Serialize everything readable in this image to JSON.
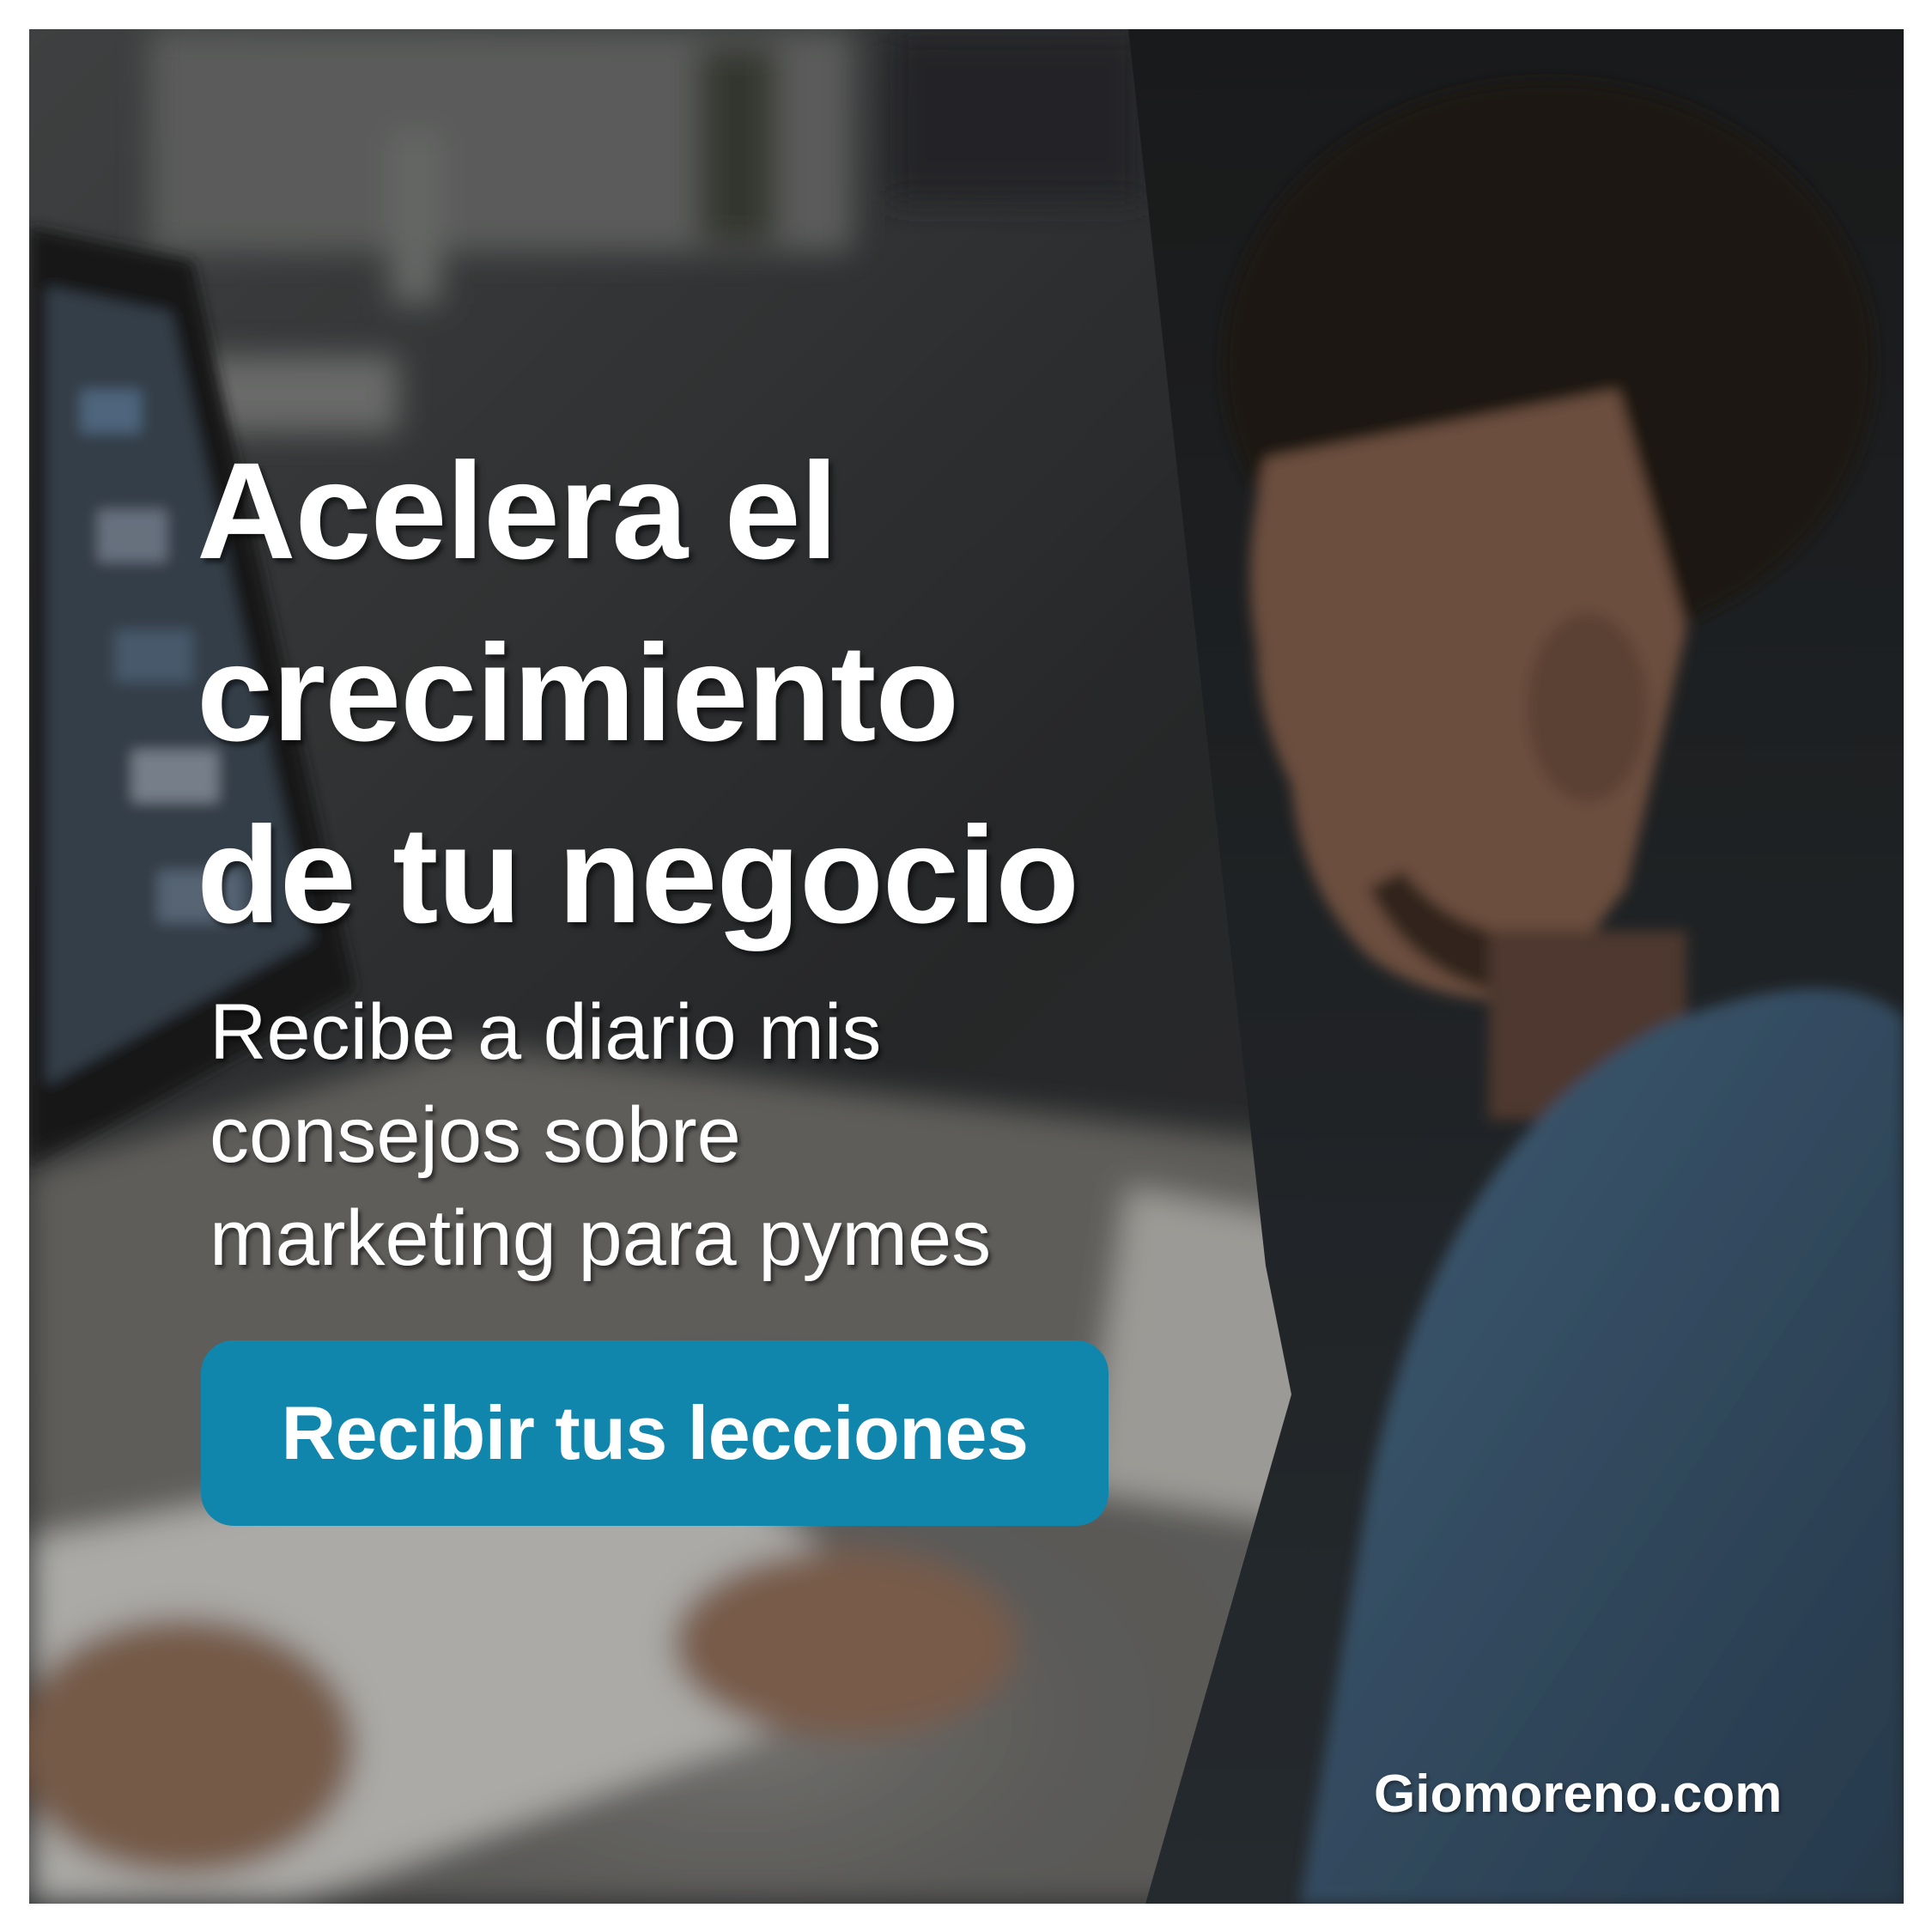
{
  "headline_lines": [
    "Acelera el",
    "crecimiento",
    "de tu negocio"
  ],
  "subheadline_lines": [
    "Recibe a diario mis",
    "consejos sobre",
    "marketing para pymes"
  ],
  "cta_label": "Recibir tus lecciones",
  "brand_url": "Giomoreno.com",
  "colors": {
    "cta_background": "#1186ad",
    "text": "#ffffff",
    "overlay": "#3a3b3d"
  }
}
